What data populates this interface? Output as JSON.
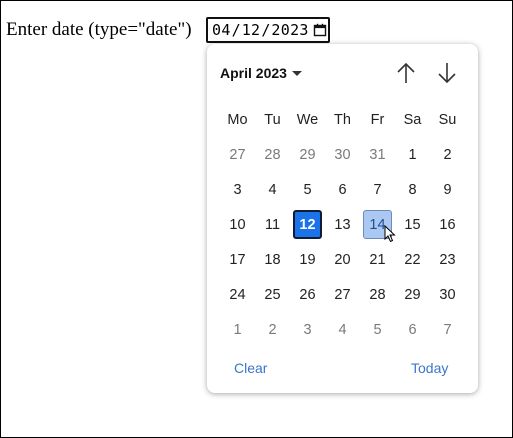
{
  "label": "Enter date (type=\"date\")",
  "input": {
    "month": "04",
    "day": "12",
    "year": "2023",
    "separator": "/"
  },
  "picker": {
    "month_label": "April 2023",
    "weekdays": [
      "Mo",
      "Tu",
      "We",
      "Th",
      "Fr",
      "Sa",
      "Su"
    ],
    "weeks": [
      [
        {
          "d": "27",
          "m": true
        },
        {
          "d": "28",
          "m": true
        },
        {
          "d": "29",
          "m": true
        },
        {
          "d": "30",
          "m": true
        },
        {
          "d": "31",
          "m": true
        },
        {
          "d": "1"
        },
        {
          "d": "2"
        }
      ],
      [
        {
          "d": "3"
        },
        {
          "d": "4"
        },
        {
          "d": "5"
        },
        {
          "d": "6"
        },
        {
          "d": "7"
        },
        {
          "d": "8"
        },
        {
          "d": "9"
        }
      ],
      [
        {
          "d": "10"
        },
        {
          "d": "11"
        },
        {
          "d": "12",
          "sel": true
        },
        {
          "d": "13"
        },
        {
          "d": "14",
          "hover": true
        },
        {
          "d": "15"
        },
        {
          "d": "16"
        }
      ],
      [
        {
          "d": "17"
        },
        {
          "d": "18"
        },
        {
          "d": "19"
        },
        {
          "d": "20"
        },
        {
          "d": "21"
        },
        {
          "d": "22"
        },
        {
          "d": "23"
        }
      ],
      [
        {
          "d": "24"
        },
        {
          "d": "25"
        },
        {
          "d": "26"
        },
        {
          "d": "27"
        },
        {
          "d": "28"
        },
        {
          "d": "29"
        },
        {
          "d": "30"
        }
      ],
      [
        {
          "d": "1",
          "m": true
        },
        {
          "d": "2",
          "m": true
        },
        {
          "d": "3",
          "m": true
        },
        {
          "d": "4",
          "m": true
        },
        {
          "d": "5",
          "m": true
        },
        {
          "d": "6",
          "m": true
        },
        {
          "d": "7",
          "m": true
        }
      ]
    ],
    "clear_label": "Clear",
    "today_label": "Today"
  },
  "icons": {
    "calendar": "calendar-icon",
    "prev": "arrow-up-icon",
    "next": "arrow-down-icon",
    "dropdown": "caret-down-icon",
    "cursor": "mouse-pointer-icon"
  },
  "colors": {
    "selected_bg": "#1a73e8",
    "hover_bg": "#aac8f2",
    "link": "#3a76c8"
  }
}
